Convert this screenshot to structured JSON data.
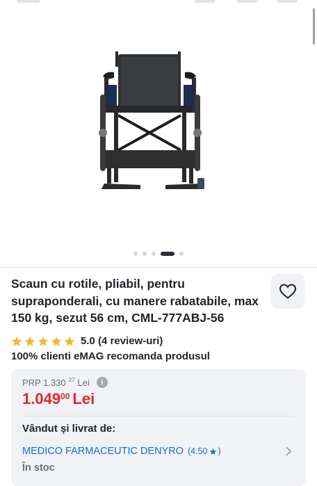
{
  "product": {
    "title": "Scaun cu rotile, pliabil, pentru supraponderali, cu manere rabatabile, max 150 kg, sezut 56 cm, CML-777ABJ-56",
    "image_icon": "wheelchair-product-photo",
    "gallery": {
      "slide_count": 5,
      "active_index": 3
    }
  },
  "rating": {
    "stars_value": 5,
    "stars_max": 5,
    "text": "5.0 (4 review-uri)",
    "recommend_text": "100% clienti eMAG recomanda produsul"
  },
  "price": {
    "prp_label": "PRP 1.330",
    "prp_decimals": "27",
    "prp_currency": "Lei",
    "info_icon": "i",
    "current_main": "1.049",
    "current_decimals": "00",
    "current_currency": "Lei"
  },
  "seller": {
    "label": "Vândut și livrat de:",
    "name": "MEDICO FARMACEUTIC DENYRO",
    "rating": "(4.50",
    "rating_close": ")",
    "stock": "În stoc"
  },
  "colors": {
    "price_red": "#e0272c",
    "link_blue": "#1a6bd8",
    "star_yellow": "#f5b82e",
    "card_bg": "#f0f2f5"
  }
}
